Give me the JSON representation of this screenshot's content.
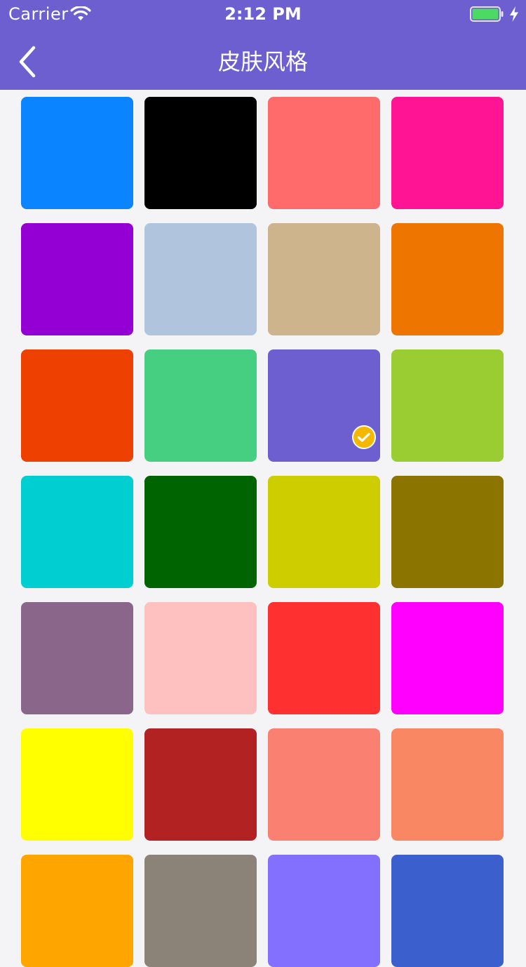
{
  "status_bar": {
    "carrier": "Carrier",
    "time": "2:12 PM",
    "wifi_icon": "wifi-icon",
    "battery_icon": "battery-full-icon",
    "charging_icon": "bolt-icon",
    "battery_color": "#4cd964"
  },
  "nav": {
    "title": "皮肤风格",
    "back_icon": "chevron-left-icon",
    "background": "#6d5fcf"
  },
  "selected_index": 10,
  "selected_icon": "checkmark-circle-icon",
  "selected_badge_color": "#f5b800",
  "swatches": [
    "#0a84ff",
    "#000000",
    "#ff6b6b",
    "#ff1493",
    "#9400d3",
    "#b0c4de",
    "#cdb48c",
    "#ee7600",
    "#ee4000",
    "#46cf80",
    "#6d5fcf",
    "#9acd32",
    "#00ced1",
    "#006400",
    "#cdcd00",
    "#8b7500",
    "#8b668b",
    "#ffc0c0",
    "#ff3030",
    "#ff00ff",
    "#ffff00",
    "#b22222",
    "#fa8072",
    "#fa8763",
    "#ffa500",
    "#8b8378",
    "#8470ff",
    "#3b5fcc"
  ]
}
